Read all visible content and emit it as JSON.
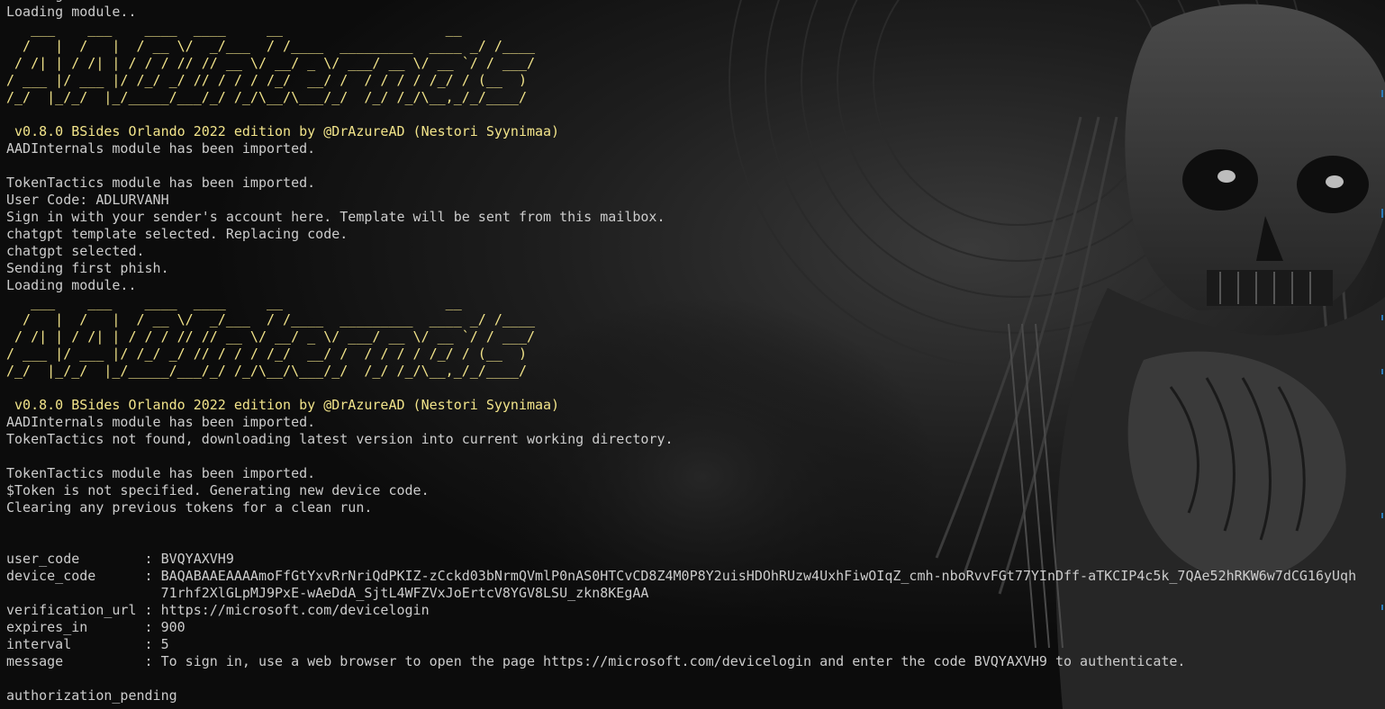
{
  "terminal": {
    "lines": [
      {
        "text": "Loading module..",
        "style": "normal"
      },
      {
        "text": "Loading module..",
        "style": "normal"
      },
      {
        "text": "   ___    ___    ____  ____     __                    __",
        "style": "ascii"
      },
      {
        "text": "  /   |  /   |  / __ \\/  _/___  / /____  _________  ____ _/ /____",
        "style": "ascii"
      },
      {
        "text": " / /| | / /| | / / / // // __ \\/ __/ _ \\/ ___/ __ \\/ __ `/ / ___/",
        "style": "ascii"
      },
      {
        "text": "/ ___ |/ ___ |/ /_/ _/ // / / / /_/  __/ /  / / / / /_/ / (__  )",
        "style": "ascii"
      },
      {
        "text": "/_/  |_/_/  |_/_____/___/_/ /_/\\__/\\___/_/  /_/ /_/\\__,_/_/____/",
        "style": "ascii"
      },
      {
        "text": "",
        "style": "normal"
      },
      {
        "text": " v0.8.0 BSides Orlando 2022 edition by @DrAzureAD (Nestori Syynimaa)",
        "style": "version"
      },
      {
        "text": "AADInternals module has been imported.",
        "style": "normal"
      },
      {
        "text": "",
        "style": "normal"
      },
      {
        "text": "TokenTactics module has been imported.",
        "style": "normal"
      },
      {
        "text": "User Code: ADLURVANH",
        "style": "normal"
      },
      {
        "text": "Sign in with your sender's account here. Template will be sent from this mailbox.",
        "style": "normal"
      },
      {
        "text": "chatgpt template selected. Replacing code.",
        "style": "normal"
      },
      {
        "text": "chatgpt selected.",
        "style": "normal"
      },
      {
        "text": "Sending first phish.",
        "style": "normal"
      },
      {
        "text": "Loading module..",
        "style": "normal"
      },
      {
        "text": "   ___    ___    ____  ____     __                    __",
        "style": "ascii"
      },
      {
        "text": "  /   |  /   |  / __ \\/  _/___  / /____  _________  ____ _/ /____",
        "style": "ascii"
      },
      {
        "text": " / /| | / /| | / / / // // __ \\/ __/ _ \\/ ___/ __ \\/ __ `/ / ___/",
        "style": "ascii"
      },
      {
        "text": "/ ___ |/ ___ |/ /_/ _/ // / / / /_/  __/ /  / / / / /_/ / (__  )",
        "style": "ascii"
      },
      {
        "text": "/_/  |_/_/  |_/_____/___/_/ /_/\\__/\\___/_/  /_/ /_/\\__,_/_/____/",
        "style": "ascii"
      },
      {
        "text": "",
        "style": "normal"
      },
      {
        "text": " v0.8.0 BSides Orlando 2022 edition by @DrAzureAD (Nestori Syynimaa)",
        "style": "version"
      },
      {
        "text": "AADInternals module has been imported.",
        "style": "normal"
      },
      {
        "text": "TokenTactics not found, downloading latest version into current working directory.",
        "style": "normal"
      },
      {
        "text": "",
        "style": "normal"
      },
      {
        "text": "TokenTactics module has been imported.",
        "style": "normal"
      },
      {
        "text": "$Token is not specified. Generating new device code.",
        "style": "normal"
      },
      {
        "text": "Clearing any previous tokens for a clean run.",
        "style": "normal"
      },
      {
        "text": "",
        "style": "normal"
      },
      {
        "text": "",
        "style": "normal"
      },
      {
        "text": "user_code        : BVQYAXVH9",
        "style": "normal"
      },
      {
        "text": "device_code      : BAQABAAEAAAAmoFfGtYxvRrNriQdPKIZ-zCckd03bNrmQVmlP0nAS0HTCvCD8Z4M0P8Y2uisHDOhRUzw4UxhFiwOIqZ_cmh-nboRvvFGt77YInDff-aTKCIP4c5k_7QAe52hRKW6w7dCG16yUqh",
        "style": "normal"
      },
      {
        "text": "                   71rhf2XlGLpMJ9PxE-wAeDdA_SjtL4WFZVxJoErtcV8YGV8LSU_zkn8KEgAA",
        "style": "normal"
      },
      {
        "text": "verification_url : https://microsoft.com/devicelogin",
        "style": "normal"
      },
      {
        "text": "expires_in       : 900",
        "style": "normal"
      },
      {
        "text": "interval         : 5",
        "style": "normal"
      },
      {
        "text": "message          : To sign in, use a web browser to open the page https://microsoft.com/devicelogin and enter the code BVQYAXVH9 to authenticate.",
        "style": "normal"
      },
      {
        "text": "",
        "style": "normal"
      },
      {
        "text": "authorization_pending",
        "style": "normal"
      }
    ]
  },
  "colors": {
    "background": "#0c0c0c",
    "text": "#cccccc",
    "ascii_banner": "#f2e48a",
    "version_banner": "#f2e48a",
    "scrollbar_marks": "#2d7bb8"
  },
  "background_image": "skull-wallpaper-icon"
}
